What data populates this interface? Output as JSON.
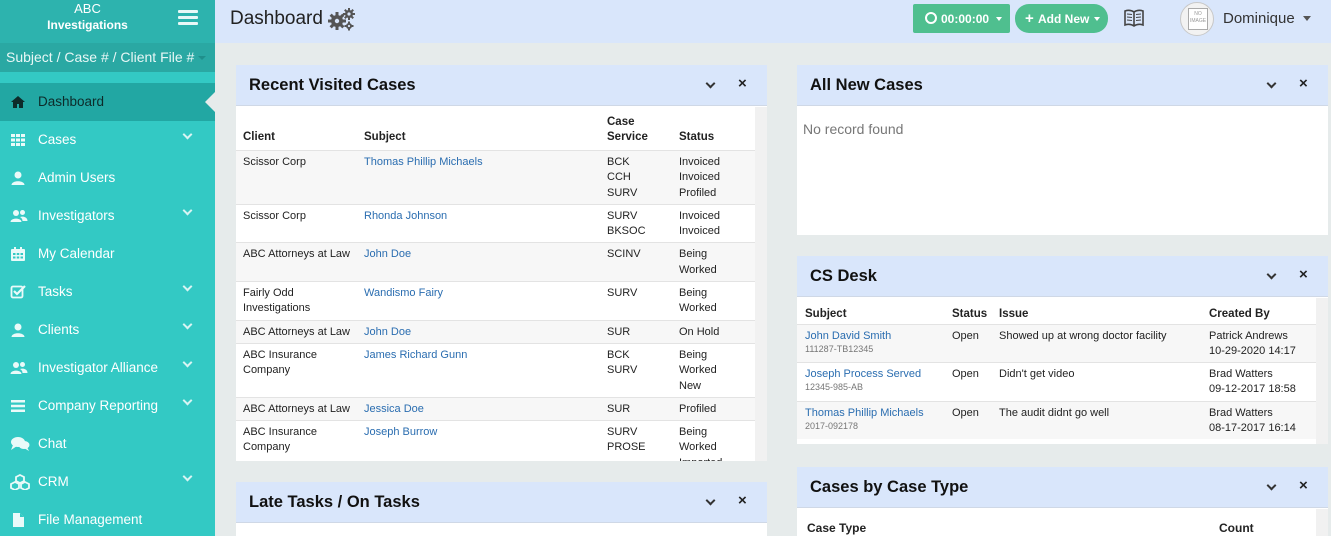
{
  "brand": {
    "line1": "ABC",
    "line2": "Investigations"
  },
  "search": {
    "placeholder": "Subject / Case # / Client File #"
  },
  "nav": [
    {
      "label": "Dashboard",
      "icon": "home-icon",
      "active": true,
      "expandable": false
    },
    {
      "label": "Cases",
      "icon": "grid-icon",
      "active": false,
      "expandable": true
    },
    {
      "label": "Admin Users",
      "icon": "user-icon",
      "active": false,
      "expandable": false
    },
    {
      "label": "Investigators",
      "icon": "users-icon",
      "active": false,
      "expandable": true
    },
    {
      "label": "My Calendar",
      "icon": "calendar-icon",
      "active": false,
      "expandable": false
    },
    {
      "label": "Tasks",
      "icon": "checkbox-icon",
      "active": false,
      "expandable": true
    },
    {
      "label": "Clients",
      "icon": "user-icon",
      "active": false,
      "expandable": true
    },
    {
      "label": "Investigator Alliance",
      "icon": "users-icon",
      "active": false,
      "expandable": true
    },
    {
      "label": "Company Reporting",
      "icon": "list-icon",
      "active": false,
      "expandable": true
    },
    {
      "label": "Chat",
      "icon": "chat-icon",
      "active": false,
      "expandable": false
    },
    {
      "label": "CRM",
      "icon": "cubes-icon",
      "active": false,
      "expandable": true
    },
    {
      "label": "File Management",
      "icon": "file-icon",
      "active": false,
      "expandable": false
    }
  ],
  "header": {
    "title": "Dashboard",
    "timer": "00:00:00",
    "add_new": "Add New",
    "user": "Dominique",
    "avatar_text": "NO IMAGE"
  },
  "recent_cases": {
    "title": "Recent Visited Cases",
    "columns": [
      "Client",
      "Subject",
      "Case Service",
      "Status"
    ],
    "rows": [
      {
        "client": "Scissor Corp",
        "subject": "Thomas Phillip Michaels",
        "service": "BCK\nCCH\nSURV",
        "status": "Invoiced\nInvoiced\nProfiled"
      },
      {
        "client": "Scissor Corp",
        "subject": "Rhonda Johnson",
        "service": "SURV\nBKSOC",
        "status": "Invoiced\nInvoiced"
      },
      {
        "client": "ABC Attorneys at Law",
        "subject": "John Doe",
        "service": "SCINV",
        "status": "Being\nWorked"
      },
      {
        "client": "Fairly Odd\nInvestigations",
        "subject": "Wandismo Fairy",
        "service": "SURV",
        "status": "Being\nWorked"
      },
      {
        "client": "ABC Attorneys at Law",
        "subject": "John Doe",
        "service": "SUR",
        "status": "On Hold"
      },
      {
        "client": "ABC Insurance\nCompany",
        "subject": "James Richard Gunn",
        "service": "BCK\nSURV",
        "status": "Being\nWorked\nNew"
      },
      {
        "client": "ABC Attorneys at Law",
        "subject": "Jessica Doe",
        "service": "SUR",
        "status": "Profiled"
      },
      {
        "client": "ABC Insurance\nCompany",
        "subject": "Joseph Burrow",
        "service": "SURV\nPROSE",
        "status": "Being\nWorked\nImported"
      }
    ]
  },
  "late_tasks": {
    "title": "Late Tasks / On Tasks"
  },
  "all_new_cases": {
    "title": "All New Cases",
    "empty": "No record found"
  },
  "cs_desk": {
    "title": "CS Desk",
    "columns": [
      "Subject",
      "Status",
      "Issue",
      "Created By"
    ],
    "rows": [
      {
        "subject": "John David Smith",
        "case_no": "111287-TB12345",
        "status": "Open",
        "issue": "Showed up at wrong doctor facility",
        "by": "Patrick Andrews",
        "date": "10-29-2020 14:17"
      },
      {
        "subject": "Joseph Process Served",
        "case_no": "12345-985-AB",
        "status": "Open",
        "issue": "Didn't get video",
        "by": "Brad Watters",
        "date": "09-12-2017 18:58"
      },
      {
        "subject": "Thomas Phillip Michaels",
        "case_no": "2017-092178",
        "status": "Open",
        "issue": "The audit didnt go well",
        "by": "Brad Watters",
        "date": "08-17-2017 16:14"
      }
    ]
  },
  "case_type": {
    "title": "Cases by Case Type",
    "columns": [
      "Case Type",
      "Count"
    ]
  },
  "colors": {
    "sidebar": "#33c9c4",
    "header": "#d9e6fb",
    "accent": "#4fbf8f",
    "link": "#2a6db0"
  }
}
